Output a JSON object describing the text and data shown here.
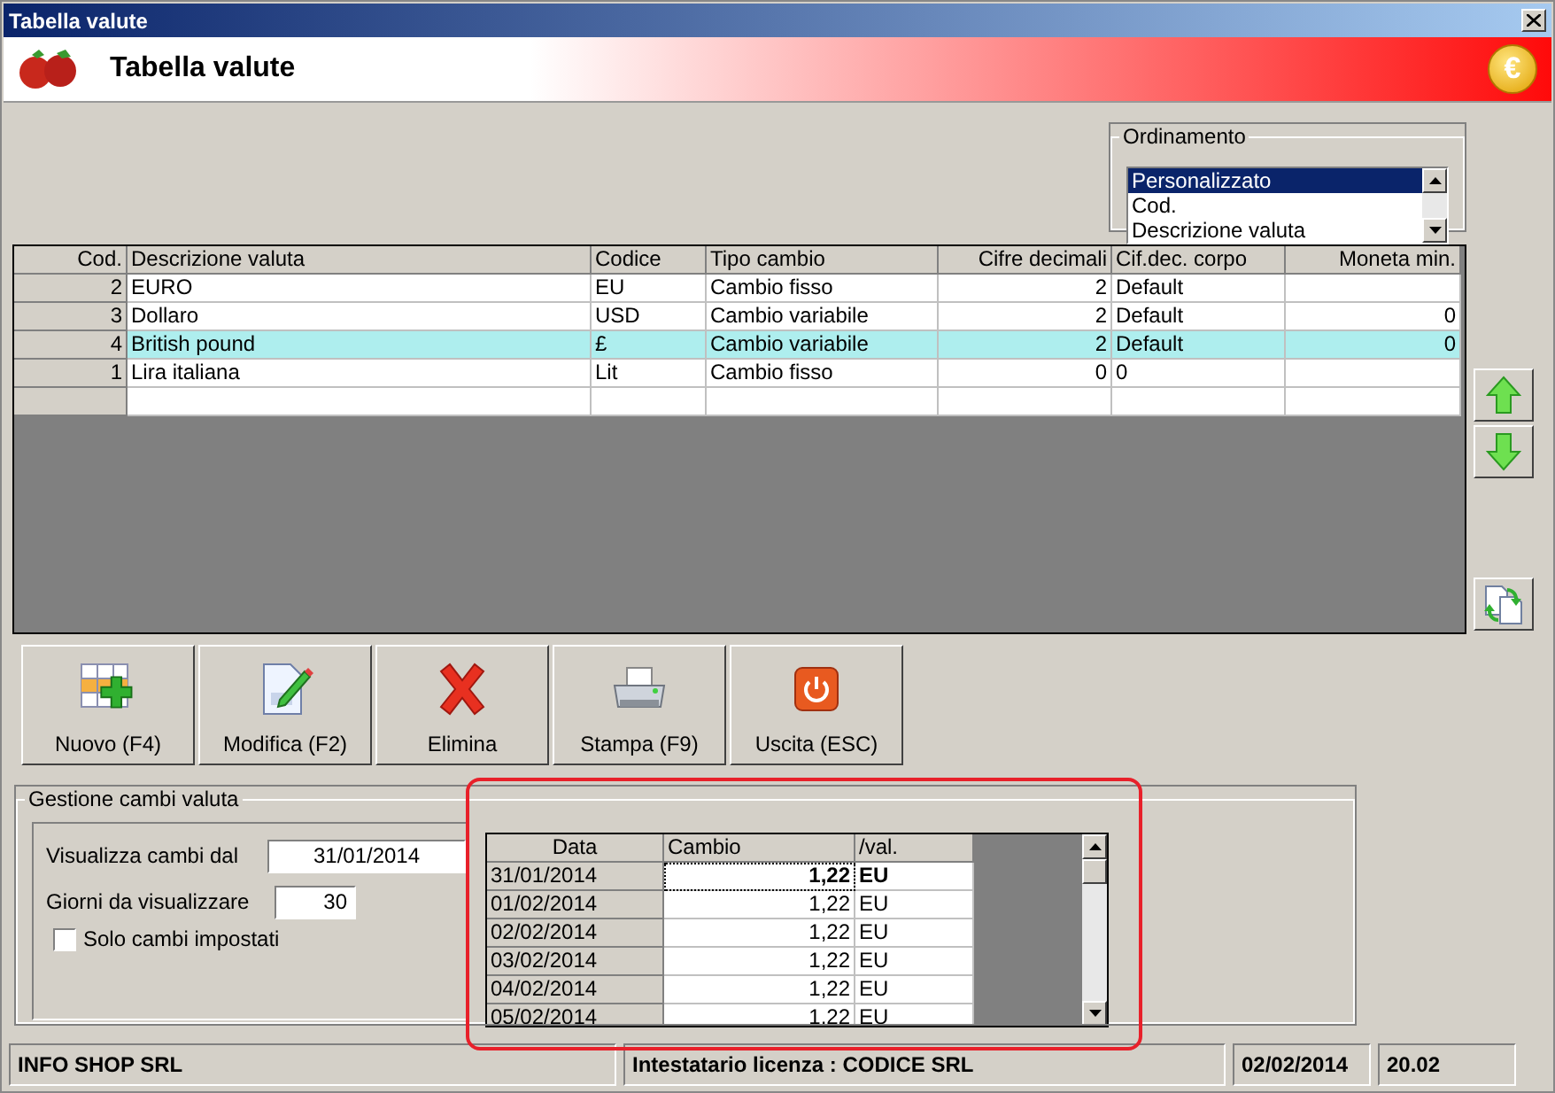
{
  "window": {
    "title": "Tabella valute"
  },
  "header": {
    "title": "Tabella valute",
    "coin_symbol": "€"
  },
  "sort_group": {
    "legend": "Ordinamento",
    "items": [
      {
        "label": "Personalizzato",
        "selected": true
      },
      {
        "label": "Cod.",
        "selected": false
      },
      {
        "label": "Descrizione valuta",
        "selected": false
      }
    ]
  },
  "currency_table": {
    "columns": [
      "Cod.",
      "Descrizione valuta",
      "Codice",
      "Tipo cambio",
      "Cifre decimali",
      "Cif.dec. corpo",
      "Moneta min."
    ],
    "rows": [
      {
        "cells": [
          "2",
          "EURO",
          "EU",
          "Cambio fisso",
          "2",
          "Default",
          ""
        ],
        "selected": false
      },
      {
        "cells": [
          "3",
          "Dollaro",
          "USD",
          "Cambio variabile",
          "2",
          "Default",
          "0"
        ],
        "selected": false
      },
      {
        "cells": [
          "4",
          "British pound",
          "£",
          "Cambio variabile",
          "2",
          "Default",
          "0"
        ],
        "selected": true
      },
      {
        "cells": [
          "1",
          "Lira italiana",
          "Lit",
          "Cambio fisso",
          "0",
          "0",
          ""
        ],
        "selected": false
      }
    ]
  },
  "side_buttons": [
    {
      "kind": "up"
    },
    {
      "kind": "down"
    },
    {
      "kind": "refresh"
    }
  ],
  "toolbar": [
    {
      "label": "Nuovo (F4)",
      "kind": "new"
    },
    {
      "label": "Modifica (F2)",
      "kind": "edit"
    },
    {
      "label": "Elimina",
      "kind": "delete"
    },
    {
      "label": "Stampa (F9)",
      "kind": "print"
    },
    {
      "label": "Uscita (ESC)",
      "kind": "exit"
    }
  ],
  "rates_group": {
    "legend": "Gestione cambi valuta",
    "date_from": {
      "label": "Visualizza cambi dal",
      "value": "31/01/2014"
    },
    "days": {
      "label": "Giorni da visualizzare",
      "value": "30"
    },
    "only_set": {
      "label": "Solo cambi impostati",
      "checked": false
    },
    "columns": [
      "Data",
      "Cambio",
      "/val."
    ],
    "rows": [
      {
        "date": "31/01/2014",
        "rate": "1,22",
        "currency": "EU",
        "selected": true
      },
      {
        "date": "01/02/2014",
        "rate": "1,22",
        "currency": "EU",
        "selected": false
      },
      {
        "date": "02/02/2014",
        "rate": "1,22",
        "currency": "EU",
        "selected": false
      },
      {
        "date": "03/02/2014",
        "rate": "1,22",
        "currency": "EU",
        "selected": false
      },
      {
        "date": "04/02/2014",
        "rate": "1,22",
        "currency": "EU",
        "selected": false
      },
      {
        "date": "05/02/2014",
        "rate": "1,22",
        "currency": "EU",
        "selected": false
      }
    ]
  },
  "status_bar": [
    "INFO SHOP SRL",
    "Intestatario licenza : CODICE SRL",
    "02/02/2014",
    "20.02"
  ]
}
